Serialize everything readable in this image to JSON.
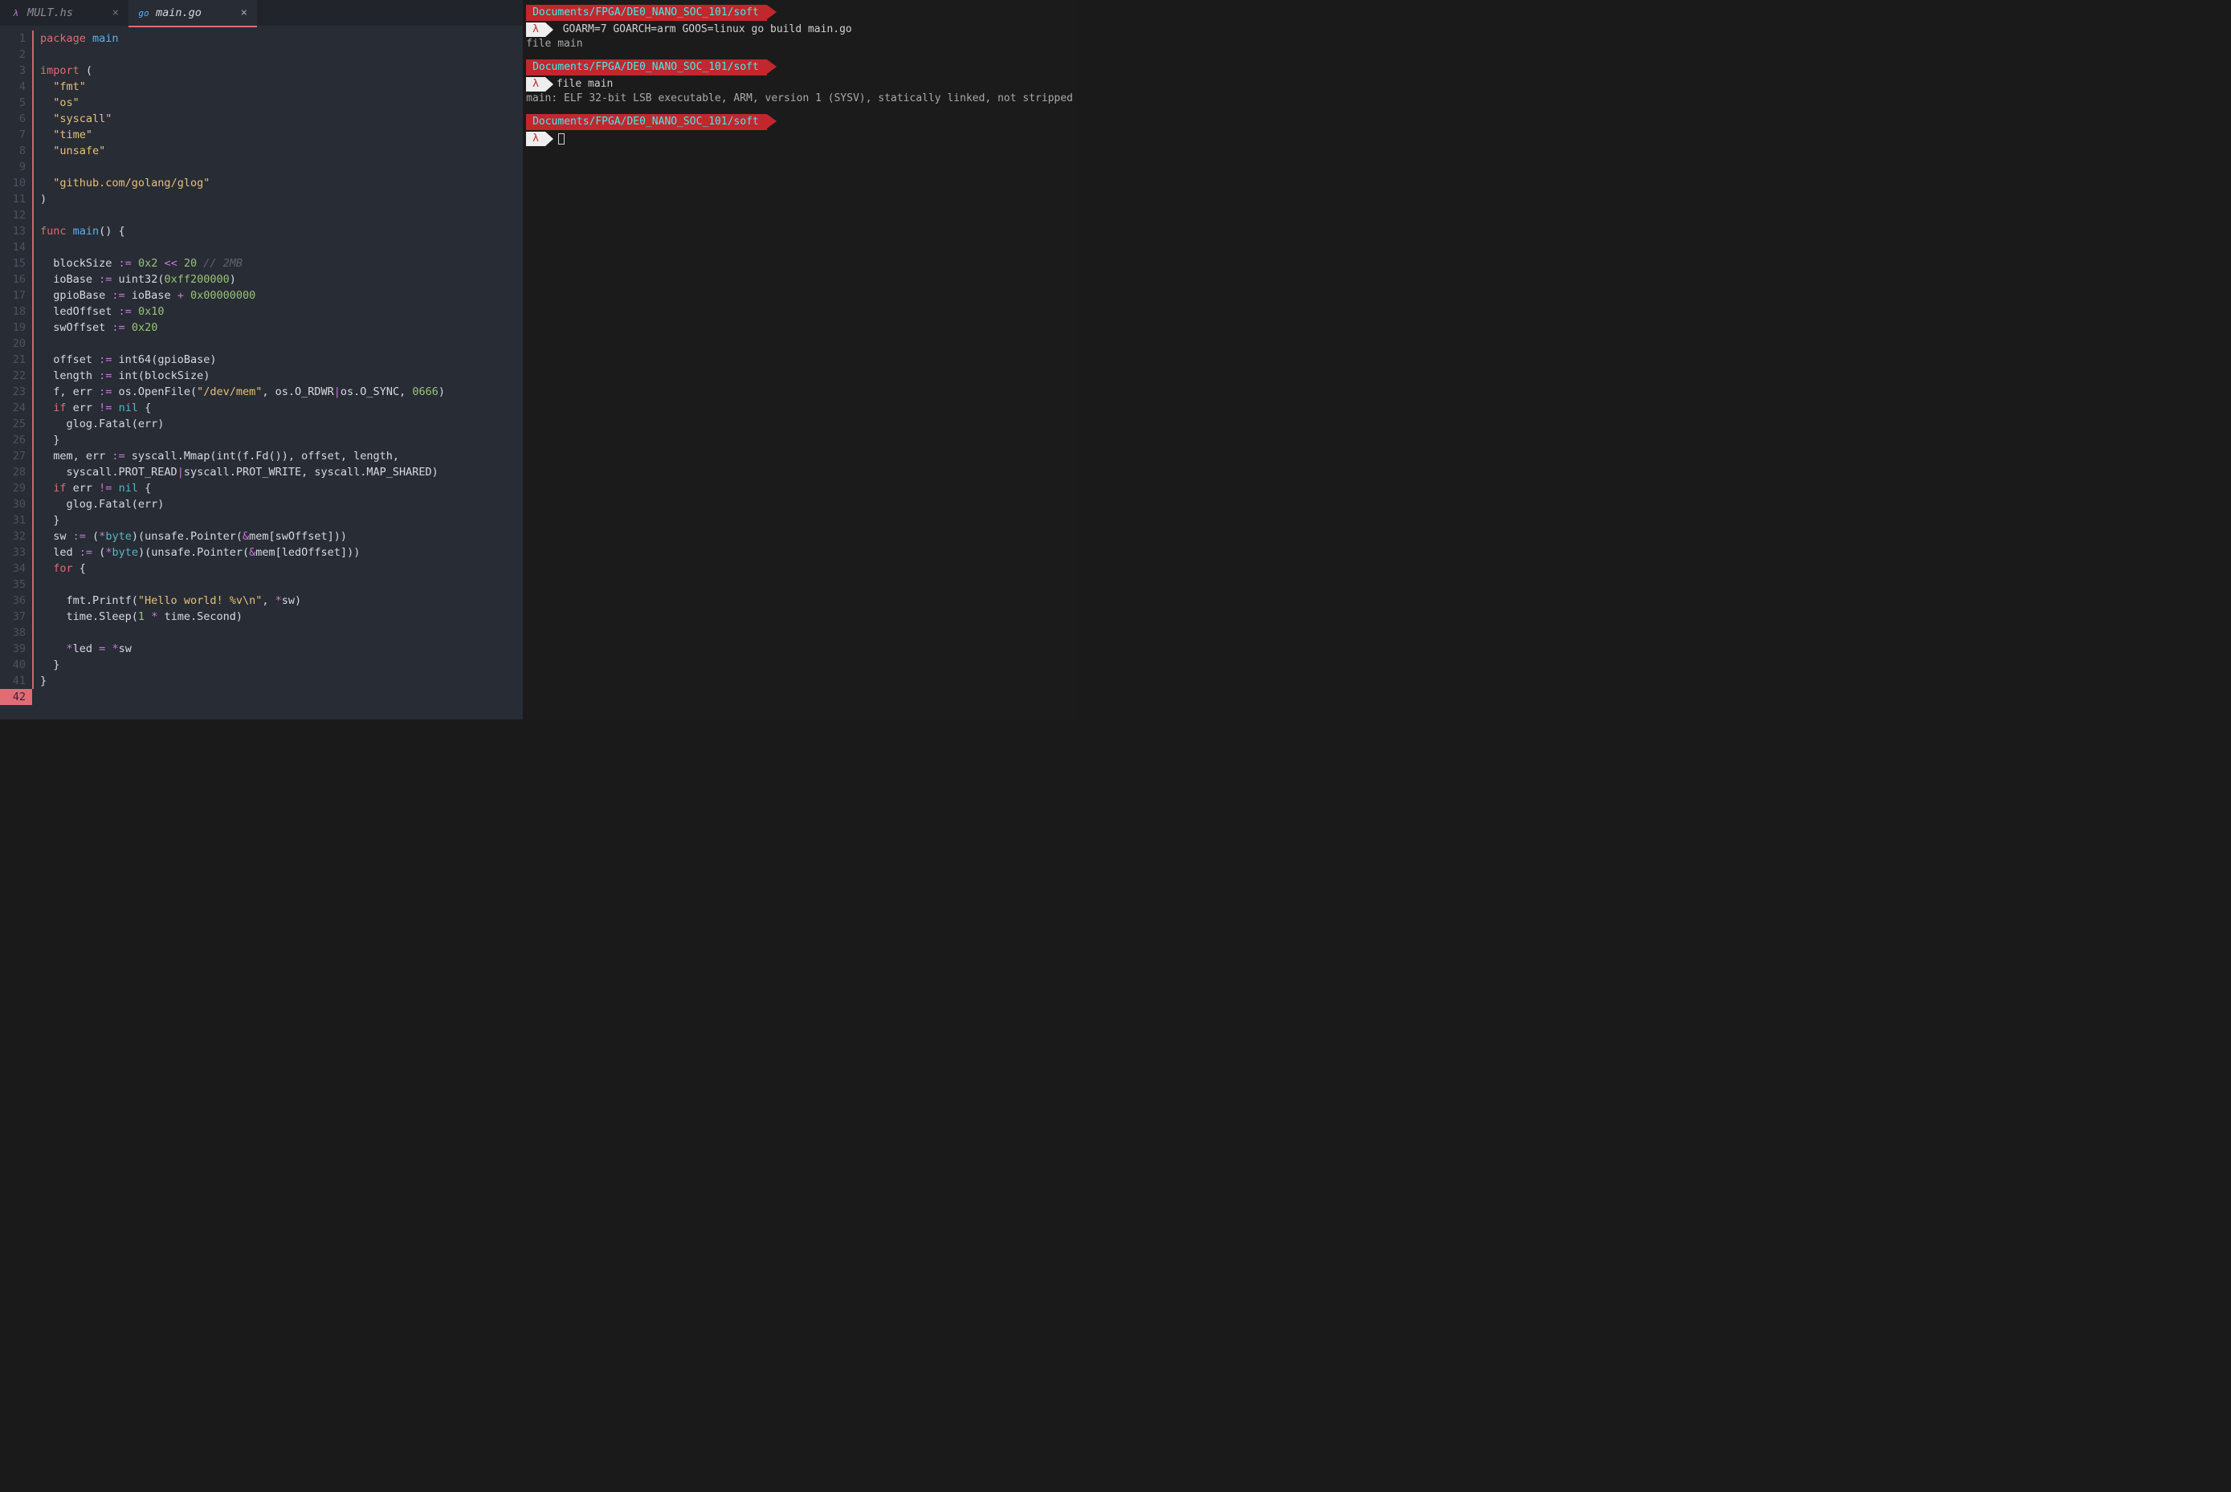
{
  "tabs": [
    {
      "label": "MULT.hs",
      "icon_color": "#c678dd",
      "icon_text": "λ"
    },
    {
      "label": "main.go",
      "icon_color": "#61afef",
      "icon_text": "go"
    }
  ],
  "active_tab_index": 1,
  "close_glyph": "×",
  "code": {
    "total_lines": 42,
    "current_line": 42,
    "lines": [
      [
        {
          "c": "kw",
          "t": "package"
        },
        {
          "c": "id",
          "t": " "
        },
        {
          "c": "fn",
          "t": "main"
        }
      ],
      [],
      [
        {
          "c": "kw",
          "t": "import"
        },
        {
          "c": "id",
          "t": " ("
        }
      ],
      [
        {
          "c": "id",
          "t": "  "
        },
        {
          "c": "str",
          "t": "\"fmt\""
        }
      ],
      [
        {
          "c": "id",
          "t": "  "
        },
        {
          "c": "str",
          "t": "\"os\""
        }
      ],
      [
        {
          "c": "id",
          "t": "  "
        },
        {
          "c": "str",
          "t": "\"syscall\""
        }
      ],
      [
        {
          "c": "id",
          "t": "  "
        },
        {
          "c": "str",
          "t": "\"time\""
        }
      ],
      [
        {
          "c": "id",
          "t": "  "
        },
        {
          "c": "str",
          "t": "\"unsafe\""
        }
      ],
      [],
      [
        {
          "c": "id",
          "t": "  "
        },
        {
          "c": "str",
          "t": "\"github.com/golang/glog\""
        }
      ],
      [
        {
          "c": "id",
          "t": ")"
        }
      ],
      [],
      [
        {
          "c": "kw",
          "t": "func"
        },
        {
          "c": "id",
          "t": " "
        },
        {
          "c": "fn",
          "t": "main"
        },
        {
          "c": "id",
          "t": "() {"
        }
      ],
      [],
      [
        {
          "c": "id",
          "t": "  blockSize "
        },
        {
          "c": "op",
          "t": ":="
        },
        {
          "c": "id",
          "t": " "
        },
        {
          "c": "num",
          "t": "0x2"
        },
        {
          "c": "id",
          "t": " "
        },
        {
          "c": "op",
          "t": "<<"
        },
        {
          "c": "id",
          "t": " "
        },
        {
          "c": "num",
          "t": "20"
        },
        {
          "c": "id",
          "t": " "
        },
        {
          "c": "cm",
          "t": "// 2MB"
        }
      ],
      [
        {
          "c": "id",
          "t": "  ioBase "
        },
        {
          "c": "op",
          "t": ":="
        },
        {
          "c": "id",
          "t": " uint32("
        },
        {
          "c": "num",
          "t": "0xff200000"
        },
        {
          "c": "id",
          "t": ")"
        }
      ],
      [
        {
          "c": "id",
          "t": "  gpioBase "
        },
        {
          "c": "op",
          "t": ":="
        },
        {
          "c": "id",
          "t": " ioBase "
        },
        {
          "c": "op",
          "t": "+"
        },
        {
          "c": "id",
          "t": " "
        },
        {
          "c": "num",
          "t": "0x00000000"
        }
      ],
      [
        {
          "c": "id",
          "t": "  ledOffset "
        },
        {
          "c": "op",
          "t": ":="
        },
        {
          "c": "id",
          "t": " "
        },
        {
          "c": "num",
          "t": "0x10"
        }
      ],
      [
        {
          "c": "id",
          "t": "  swOffset "
        },
        {
          "c": "op",
          "t": ":="
        },
        {
          "c": "id",
          "t": " "
        },
        {
          "c": "num",
          "t": "0x20"
        }
      ],
      [],
      [
        {
          "c": "id",
          "t": "  offset "
        },
        {
          "c": "op",
          "t": ":="
        },
        {
          "c": "id",
          "t": " int64(gpioBase)"
        }
      ],
      [
        {
          "c": "id",
          "t": "  length "
        },
        {
          "c": "op",
          "t": ":="
        },
        {
          "c": "id",
          "t": " int(blockSize)"
        }
      ],
      [
        {
          "c": "id",
          "t": "  f, err "
        },
        {
          "c": "op",
          "t": ":="
        },
        {
          "c": "id",
          "t": " os.OpenFile("
        },
        {
          "c": "str",
          "t": "\"/dev/mem\""
        },
        {
          "c": "id",
          "t": ", os.O_RDWR"
        },
        {
          "c": "op",
          "t": "|"
        },
        {
          "c": "id",
          "t": "os.O_SYNC, "
        },
        {
          "c": "num",
          "t": "0666"
        },
        {
          "c": "id",
          "t": ")"
        }
      ],
      [
        {
          "c": "id",
          "t": "  "
        },
        {
          "c": "kw",
          "t": "if"
        },
        {
          "c": "id",
          "t": " err "
        },
        {
          "c": "op",
          "t": "!="
        },
        {
          "c": "id",
          "t": " "
        },
        {
          "c": "ty",
          "t": "nil"
        },
        {
          "c": "id",
          "t": " {"
        }
      ],
      [
        {
          "c": "id",
          "t": "    glog.Fatal(err)"
        }
      ],
      [
        {
          "c": "id",
          "t": "  }"
        }
      ],
      [
        {
          "c": "id",
          "t": "  mem, err "
        },
        {
          "c": "op",
          "t": ":="
        },
        {
          "c": "id",
          "t": " syscall.Mmap(int(f.Fd()), offset, length,"
        }
      ],
      [
        {
          "c": "id",
          "t": "    syscall.PROT_READ"
        },
        {
          "c": "op",
          "t": "|"
        },
        {
          "c": "id",
          "t": "syscall.PROT_WRITE, syscall.MAP_SHARED)"
        }
      ],
      [
        {
          "c": "id",
          "t": "  "
        },
        {
          "c": "kw",
          "t": "if"
        },
        {
          "c": "id",
          "t": " err "
        },
        {
          "c": "op",
          "t": "!="
        },
        {
          "c": "id",
          "t": " "
        },
        {
          "c": "ty",
          "t": "nil"
        },
        {
          "c": "id",
          "t": " {"
        }
      ],
      [
        {
          "c": "id",
          "t": "    glog.Fatal(err)"
        }
      ],
      [
        {
          "c": "id",
          "t": "  }"
        }
      ],
      [
        {
          "c": "id",
          "t": "  sw "
        },
        {
          "c": "op",
          "t": ":="
        },
        {
          "c": "id",
          "t": " ("
        },
        {
          "c": "star",
          "t": "*"
        },
        {
          "c": "ty",
          "t": "byte"
        },
        {
          "c": "id",
          "t": ")(unsafe.Pointer("
        },
        {
          "c": "op",
          "t": "&"
        },
        {
          "c": "id",
          "t": "mem[swOffset]))"
        }
      ],
      [
        {
          "c": "id",
          "t": "  led "
        },
        {
          "c": "op",
          "t": ":="
        },
        {
          "c": "id",
          "t": " ("
        },
        {
          "c": "star",
          "t": "*"
        },
        {
          "c": "ty",
          "t": "byte"
        },
        {
          "c": "id",
          "t": ")(unsafe.Pointer("
        },
        {
          "c": "op",
          "t": "&"
        },
        {
          "c": "id",
          "t": "mem[ledOffset]))"
        }
      ],
      [
        {
          "c": "id",
          "t": "  "
        },
        {
          "c": "kw",
          "t": "for"
        },
        {
          "c": "id",
          "t": " {"
        }
      ],
      [],
      [
        {
          "c": "id",
          "t": "    fmt.Printf("
        },
        {
          "c": "str",
          "t": "\"Hello world! %v\\n\""
        },
        {
          "c": "id",
          "t": ", "
        },
        {
          "c": "star",
          "t": "*"
        },
        {
          "c": "id",
          "t": "sw)"
        }
      ],
      [
        {
          "c": "id",
          "t": "    time.Sleep("
        },
        {
          "c": "num",
          "t": "1"
        },
        {
          "c": "id",
          "t": " "
        },
        {
          "c": "op",
          "t": "*"
        },
        {
          "c": "id",
          "t": " time.Second)"
        }
      ],
      [],
      [
        {
          "c": "id",
          "t": "    "
        },
        {
          "c": "star",
          "t": "*"
        },
        {
          "c": "id",
          "t": "led "
        },
        {
          "c": "op",
          "t": "="
        },
        {
          "c": "id",
          "t": " "
        },
        {
          "c": "star",
          "t": "*"
        },
        {
          "c": "id",
          "t": "sw"
        }
      ],
      [
        {
          "c": "id",
          "t": "  }"
        }
      ],
      [
        {
          "c": "id",
          "t": "}"
        }
      ],
      []
    ],
    "guides": {
      "red_first": 1,
      "red_last": 41,
      "grey": [
        [
          25,
          25
        ],
        [
          28,
          28
        ],
        [
          30,
          30
        ],
        [
          36,
          37
        ],
        [
          39,
          39
        ]
      ]
    }
  },
  "terminal": {
    "dir": "Documents/FPGA/DE0_NANO_SOC_101/soft",
    "lambda": "λ",
    "blocks": [
      {
        "cmd": " GOARM=7 GOARCH=arm GOOS=linux go build main.go",
        "out": [
          "file main"
        ]
      },
      {
        "cmd": "file main",
        "out": [
          "main: ELF 32-bit LSB executable, ARM, version 1 (SYSV), statically linked, not stripped"
        ]
      },
      {
        "cmd": "",
        "out": []
      }
    ]
  }
}
